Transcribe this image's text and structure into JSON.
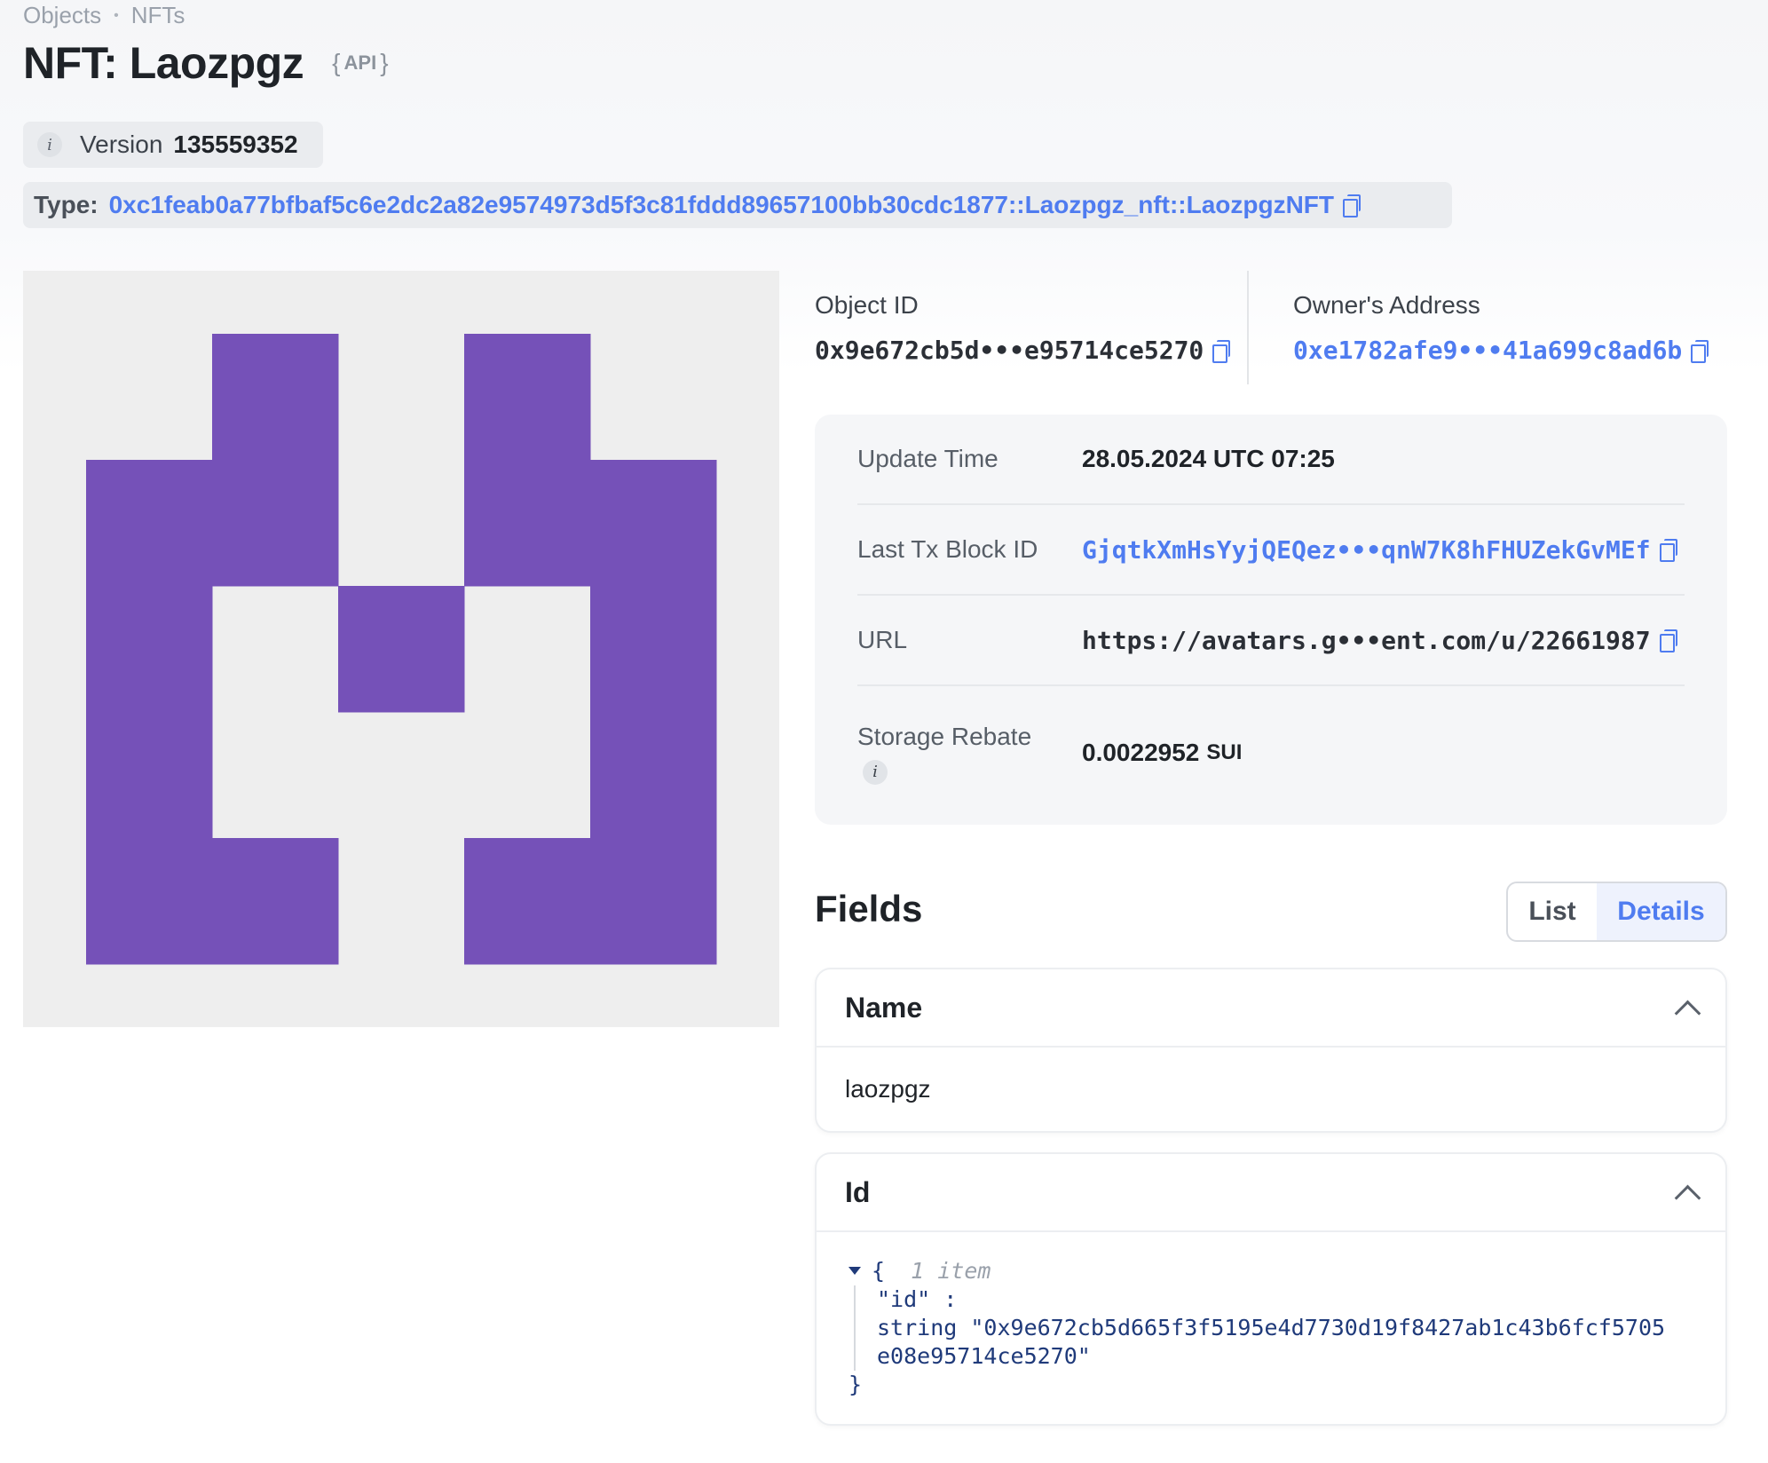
{
  "breadcrumb": {
    "items": [
      "Objects",
      "NFTs"
    ],
    "separator": "•"
  },
  "title": "NFT: Laozpgz",
  "api_badge": {
    "open": "{",
    "label": "API",
    "close": "}"
  },
  "version": {
    "label": "Version",
    "value": "135559352"
  },
  "type": {
    "label": "Type:",
    "value": "0xc1feab0a77bfbaf5c6e2dc2a82e9574973d5f3c81fddd89657100bb30cdc1877::Laozpgz_nft::LaozpgzNFT"
  },
  "nft_image": {
    "fill_color": "#7551b8",
    "background_color": "#eeeeee"
  },
  "object_id": {
    "label": "Object ID",
    "value": "0x9e672cb5d•••e95714ce5270"
  },
  "owner": {
    "label": "Owner's Address",
    "value": "0xe1782afe9•••41a699c8ad6b"
  },
  "details": {
    "update_time": {
      "label": "Update Time",
      "value": "28.05.2024 UTC 07:25"
    },
    "last_tx": {
      "label": "Last Tx Block ID",
      "value": "GjqtkXmHsYyjQEQez•••qnW7K8hFHUZekGvMEf"
    },
    "url": {
      "label": "URL",
      "value": "https://avatars.g•••ent.com/u/22661987"
    },
    "storage_rebate": {
      "label": "Storage Rebate",
      "value": "0.0022952",
      "unit": "SUI"
    }
  },
  "fields": {
    "title": "Fields",
    "toggle": {
      "list": "List",
      "details": "Details",
      "selected": "Details"
    },
    "name_field": {
      "label": "Name",
      "value": "laozpgz"
    },
    "id_field": {
      "label": "Id",
      "json_open": "{",
      "json_count": "1 item",
      "json_key": "\"id\" :",
      "json_type": "string",
      "json_value_line1": "\"0x9e672cb5d665f3f5195e4d7730d19f8427ab1c43b6fcf5705",
      "json_value_line2": "e08e95714ce5270\"",
      "json_close": "}"
    }
  },
  "colors": {
    "accent": "#4f7cf0",
    "nft_purple": "#7551b8"
  }
}
